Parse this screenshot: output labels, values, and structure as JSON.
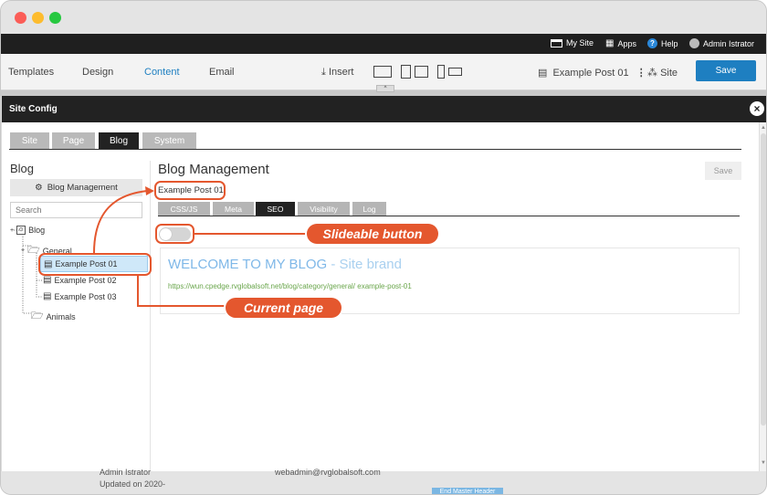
{
  "topbar": {
    "my_site": "My Site",
    "apps": "Apps",
    "help": "Help",
    "user": "Admin Istrator"
  },
  "menu": {
    "templates": "Templates",
    "design": "Design",
    "content": "Content",
    "email": "Email",
    "insert": "Insert",
    "page_name": "Example Post 01",
    "site": "Site",
    "save": "Save"
  },
  "modal": {
    "title": "Site Config"
  },
  "tabs": [
    "Site",
    "Page",
    "Blog",
    "System"
  ],
  "left": {
    "heading": "Blog",
    "blog_management": "Blog Management",
    "search_placeholder": "Search",
    "tree": {
      "blog": "Blog",
      "general": "General",
      "post1": "Example Post 01",
      "post2": "Example Post 02",
      "post3": "Example Post 03",
      "animals": "Animals"
    }
  },
  "right": {
    "title": "Blog Management",
    "save": "Save",
    "current_post": "Example Post 01",
    "subtabs": [
      "CSS/JS",
      "Meta",
      "SEO",
      "Visibility",
      "Log"
    ],
    "preview_title": "WELCOME TO MY BLOG",
    "preview_brand": "- Site brand",
    "preview_url": "https://wun.cpedge.rvglobalsoft.net/blog/category/general/ example-post-01"
  },
  "callouts": {
    "slideable": "Slideable button",
    "current": "Current page"
  },
  "background": {
    "name": "Admin Istrator",
    "updated": "Updated on 2020-",
    "email": "webadmin@rvglobalsoft.com",
    "badge": "End Master Header"
  },
  "colors": {
    "accent": "#1e7fc1",
    "callout": "#e4572e",
    "selected": "#cfe8f9"
  }
}
